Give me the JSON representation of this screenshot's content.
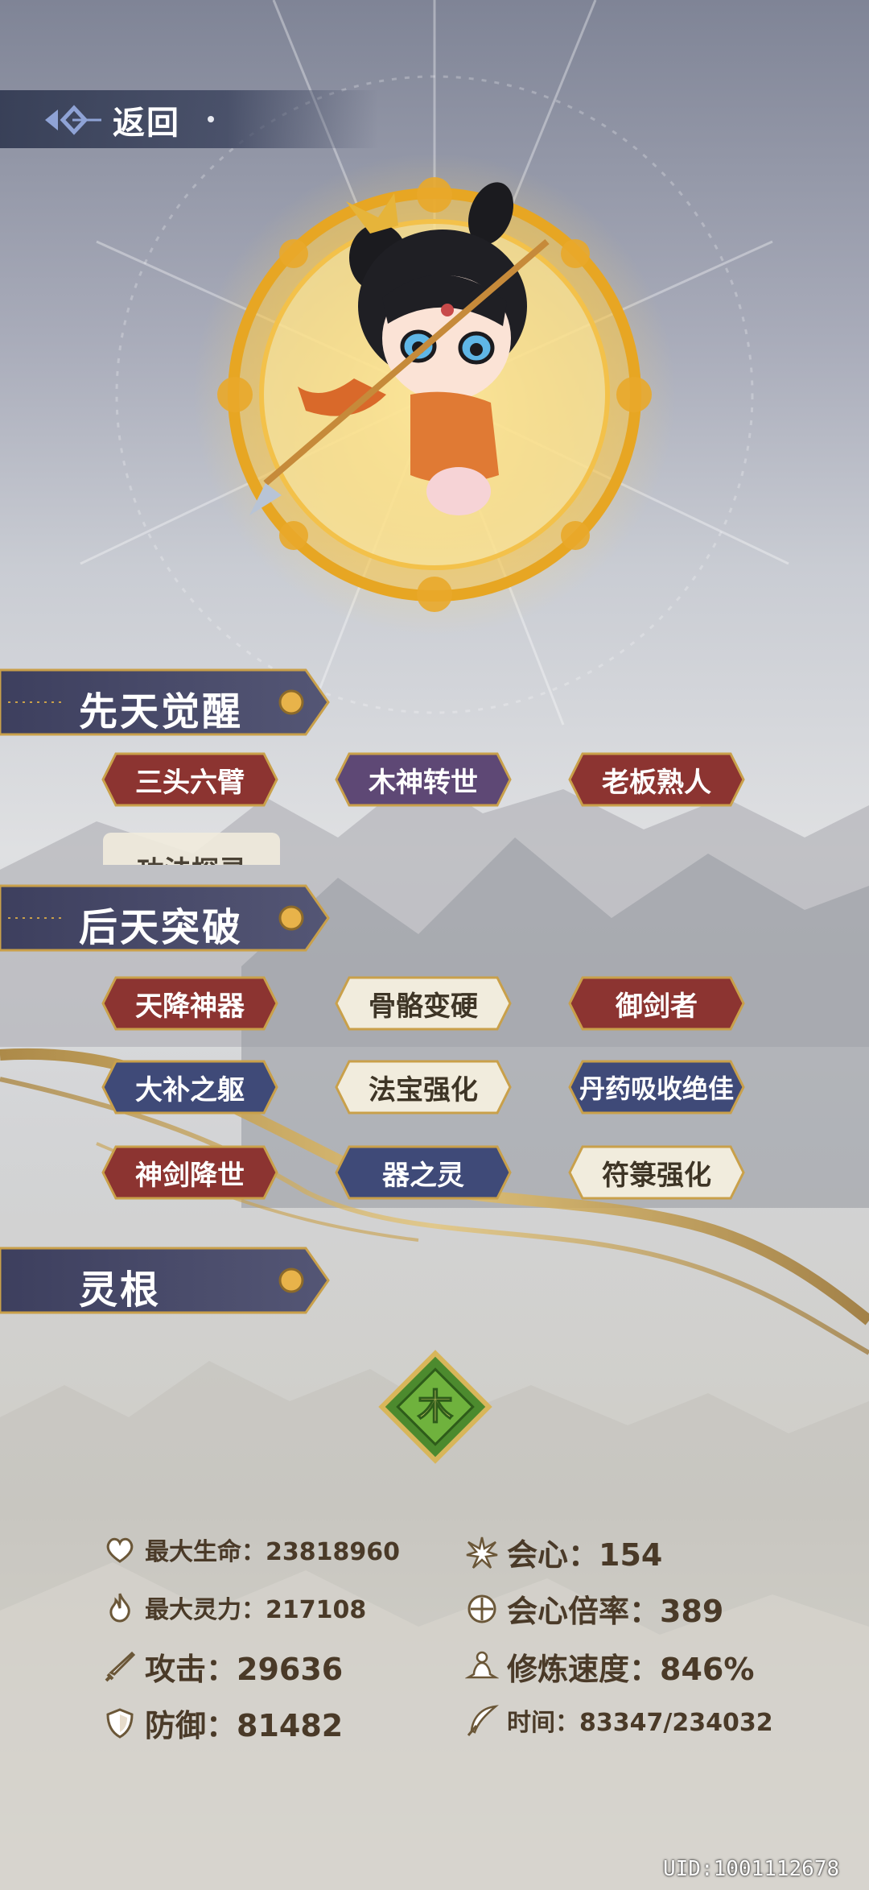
{
  "header": {
    "back_label": "返回"
  },
  "sections": {
    "innate": {
      "title": "先天觉醒",
      "tags": [
        {
          "label": "三头六臂",
          "style": "red"
        },
        {
          "label": "木神转世",
          "style": "purple"
        },
        {
          "label": "老板熟人",
          "style": "red"
        }
      ],
      "hidden_tag_label": "功法探灵"
    },
    "acquired": {
      "title": "后天突破",
      "tags": [
        {
          "label": "天降神器",
          "style": "red"
        },
        {
          "label": "骨骼变硬",
          "style": "cream"
        },
        {
          "label": "御剑者",
          "style": "red"
        },
        {
          "label": "大补之躯",
          "style": "blue"
        },
        {
          "label": "法宝强化",
          "style": "cream"
        },
        {
          "label": "丹药吸收绝佳",
          "style": "blue"
        },
        {
          "label": "神剑降世",
          "style": "red"
        },
        {
          "label": "器之灵",
          "style": "blue"
        },
        {
          "label": "符箓强化",
          "style": "cream"
        }
      ]
    },
    "spirit_root": {
      "title": "灵根",
      "element": "木"
    }
  },
  "stats": {
    "max_hp": "最大生命：23818960",
    "max_mana": "最大灵力：217108",
    "attack": "攻击：29636",
    "defense": "防御：81482",
    "crit": "会心：154",
    "crit_multiplier": "会心倍率：389",
    "cultivation_speed": "修炼速度：846%",
    "time": "时间：83347/234032"
  },
  "uid": "UID:1001112678",
  "colors": {
    "red": "#8c3431",
    "purple": "#5e4875",
    "blue": "#3f4a78",
    "cream": "#f1ecdd",
    "gold": "#c9a04a",
    "element_green": "#4c8a2e"
  },
  "icons": [
    "back-diamond-icon",
    "heart-icon",
    "flame-icon",
    "sword-icon",
    "shield-icon",
    "burst-icon",
    "crit-rate-icon",
    "meditation-icon",
    "feather-icon"
  ]
}
